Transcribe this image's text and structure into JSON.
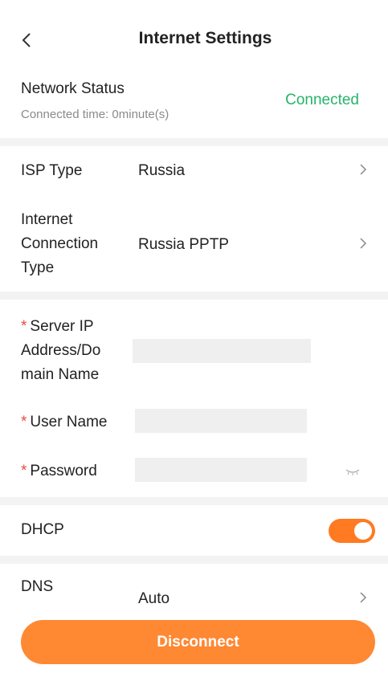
{
  "header": {
    "title": "Internet Settings",
    "back_icon": "chevron-left-icon"
  },
  "network_status": {
    "label": "Network Status",
    "connected_time": "Connected time: 0minute(s)",
    "value": "Connected",
    "value_color": "#27b36b"
  },
  "isp": {
    "label": "ISP Type",
    "value": "Russia"
  },
  "connection_type": {
    "label_line1": "Internet",
    "label_line2": "Connection",
    "label_line3": "Type",
    "value": "Russia PPTP"
  },
  "server": {
    "required": "*",
    "label_line1": "Server IP",
    "label_line2": "Address/Do",
    "label_line3": "main Name",
    "value": ""
  },
  "username": {
    "required": "*",
    "label": "User Name",
    "value": ""
  },
  "password": {
    "required": "*",
    "label": "Password",
    "value": "",
    "toggle_icon": "eye-closed-icon"
  },
  "dhcp": {
    "label": "DHCP",
    "enabled": true,
    "accent": "#ff7a20"
  },
  "dns": {
    "label": "DNS",
    "value": "Auto"
  },
  "disconnect": {
    "label": "Disconnect",
    "color": "#ff8833"
  }
}
